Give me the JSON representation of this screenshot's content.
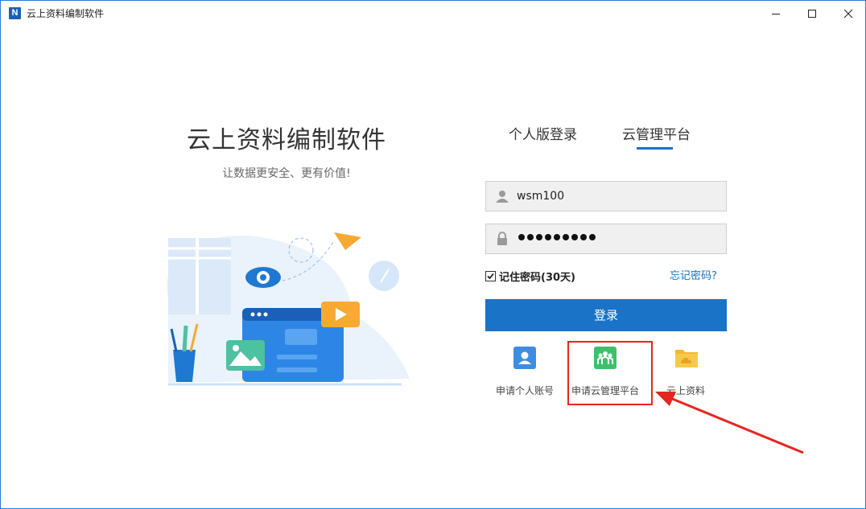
{
  "window": {
    "app_icon_letter": "N",
    "title": "云上资料编制软件",
    "controls": {
      "minimize_icon": "minimize-icon",
      "maximize_icon": "maximize-icon",
      "close_icon": "close-icon"
    }
  },
  "hero": {
    "title": "云上资料编制软件",
    "subtitle": "让数据更安全、更有价值!"
  },
  "tabs": [
    {
      "label": "个人版登录",
      "active": false
    },
    {
      "label": "云管理平台",
      "active": true
    }
  ],
  "form": {
    "username": "wsm100",
    "password_mask_length": 9,
    "remember_label": "记住密码(30天)",
    "remember_checked": true,
    "forgot_label": "忘记密码?",
    "login_label": "登录"
  },
  "actions": [
    {
      "label": "申请个人账号",
      "icon": "user-card-icon",
      "color": "#3f8de0"
    },
    {
      "label": "申请云管理平台",
      "icon": "group-icon",
      "color": "#3fbf6a"
    },
    {
      "label": "云上资料",
      "icon": "cloud-folder-icon",
      "color": "#f5b731"
    }
  ],
  "colors": {
    "accent": "#1a73c6",
    "highlight": "#e5251f"
  }
}
